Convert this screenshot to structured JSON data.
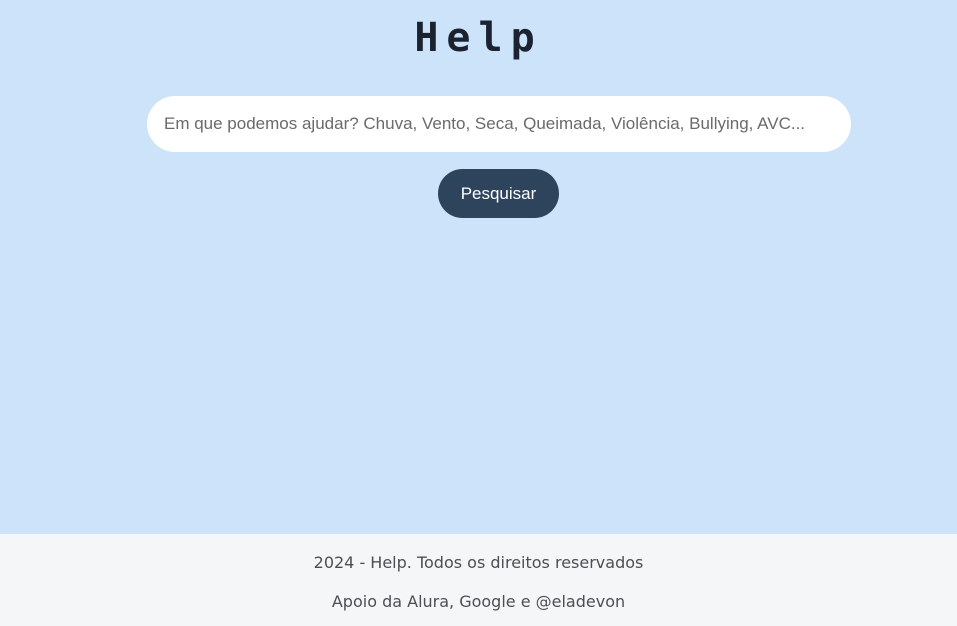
{
  "header": {
    "title": "Help"
  },
  "search": {
    "placeholder": "Em que podemos ajudar? Chuva, Vento, Seca, Queimada, Violência, Bullying, AVC...",
    "value": "",
    "button_label": "Pesquisar"
  },
  "footer": {
    "copyright": "2024 - Help. Todos os direitos reservados",
    "support": "Apoio da Alura, Google e @eladevon"
  },
  "colors": {
    "background": "#cce3fa",
    "button": "#2e445c",
    "footer_background": "#f5f6f7"
  }
}
